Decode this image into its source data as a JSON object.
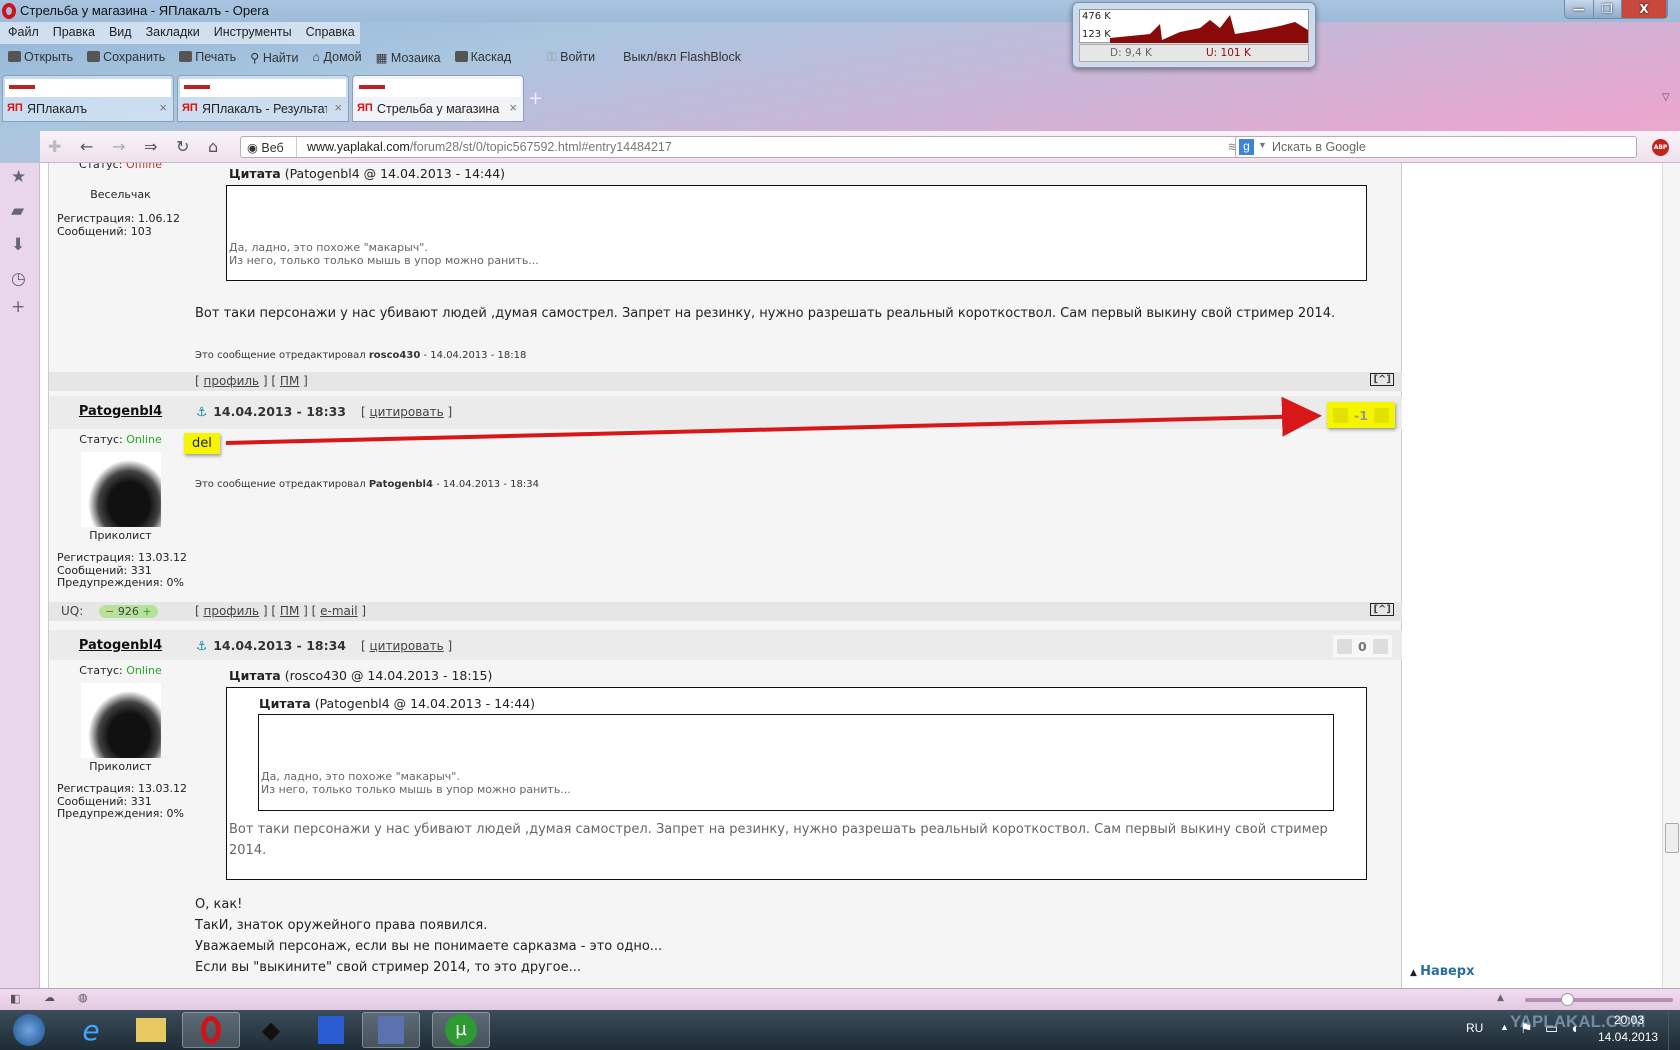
{
  "window": {
    "title": "Стрельба у магазина - ЯПлакалъ - Opera",
    "controls": [
      "—",
      "❐",
      "X"
    ]
  },
  "menu": [
    "Файл",
    "Правка",
    "Вид",
    "Закладки",
    "Инструменты",
    "Справка"
  ],
  "toolbar": [
    "Открыть",
    "Сохранить",
    "Печать",
    "Найти",
    "Домой",
    "Мозаика",
    "Каскад",
    "Войти",
    "Выкл/вкл FlashBlock"
  ],
  "netmon": {
    "max": "476 K",
    "mid": "123 K",
    "down": "D: 9,4 K",
    "up": "U: 101 K"
  },
  "tabs": [
    {
      "label": "ЯПлакалъ",
      "icon": "ЯП"
    },
    {
      "label": "ЯПлакалъ - Результат...",
      "icon": "ЯП"
    },
    {
      "label": "Стрельба у магазина ...",
      "icon": "ЯП"
    }
  ],
  "address": {
    "web_label": "Веб",
    "url_host": "www.yaplakal.com",
    "url_path": "/forum28/st/0/topic567592.html#entry14484217",
    "search_placeholder": "Искать в Google",
    "abp": "ABP"
  },
  "post1": {
    "status_label": "Статус:",
    "status": "Offline",
    "rank": "Весельчак",
    "reg": "Регистрация: 1.06.12",
    "msgs": "Сообщений: 103",
    "quote_title": "Цитата",
    "quote_meta": "(Patogenbl4 @ 14.04.2013 - 14:44)",
    "quote_lines": [
      "Да, ладно, это похоже \"макарыч\".",
      "Из него, только только мышь в упор можно ранить..."
    ],
    "body": "Вот таки персонажи у нас убивают людей ,думая самострел. Запрет на резинку, нужно разрешать реальный короткоствол. Сам первый выкину свой стример 2014.",
    "edited_prefix": "Это сообщение отредактировал",
    "edited_user": "rosco430",
    "edited_time": "- 14.04.2013 - 18:18",
    "links": [
      "профиль",
      "ПМ"
    ]
  },
  "post2": {
    "nick": "Patogenbl4",
    "date": "14.04.2013 - 18:33",
    "cite": "цитировать",
    "vote": "-1",
    "status_label": "Статус:",
    "status": "Online",
    "rank": "Приколист",
    "reg": "Регистрация: 13.03.12",
    "msgs": "Сообщений: 331",
    "warn": "Предупреждения: 0%",
    "body": "del",
    "edited_prefix": "Это сообщение отредактировал",
    "edited_user": "Patogenbl4",
    "edited_time": "- 14.04.2013 - 18:34",
    "uq_label": "UQ:",
    "uq": "926",
    "links": [
      "профиль",
      "ПМ",
      "e-mail"
    ]
  },
  "post3": {
    "nick": "Patogenbl4",
    "date": "14.04.2013 - 18:34",
    "cite": "цитировать",
    "vote": "0",
    "status_label": "Статус:",
    "status": "Online",
    "rank": "Приколист",
    "reg": "Регистрация: 13.03.12",
    "msgs": "Сообщений: 331",
    "warn": "Предупреждения: 0%",
    "quote_title": "Цитата",
    "quote_meta": "(rosco430 @ 14.04.2013 - 18:15)",
    "inner_quote_title": "Цитата",
    "inner_quote_meta": "(Patogenbl4 @ 14.04.2013 - 14:44)",
    "inner_lines": [
      "Да, ладно, это похоже \"макарыч\".",
      "Из него, только только мышь в упор можно ранить..."
    ],
    "quoted_body": "Вот таки персонажи у нас убивают людей ,думая самострел. Запрет на резинку, нужно разрешать реальный короткоствол. Сам первый выкину свой стример 2014.",
    "lines": [
      "О, как!",
      "ТакИ, знаток оружейного права появился.",
      "Уважаемый персонаж, если вы не понимаете сарказма - это одно...",
      "Если вы \"выкините\" свой стример 2014, то это другое..."
    ]
  },
  "top_marker": "[^]",
  "naverh": "Наверх",
  "taskbar": {
    "lang": "RU",
    "time": "20:03",
    "date": "14.04.2013",
    "watermark": "YAPLAKAL.COM"
  }
}
